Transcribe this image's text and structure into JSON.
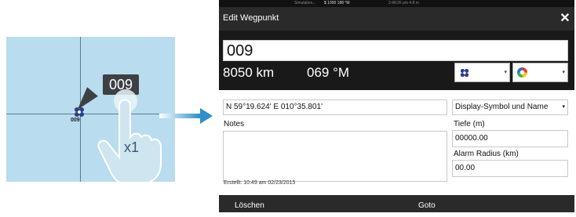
{
  "illustration": {
    "bubble_text": "009",
    "waypoint_label": "009",
    "tap_count": "x1"
  },
  "statusbar": {
    "left": "Simulation...",
    "mid": "$ 1000  188 °M",
    "time": "2:48:26 pm  4.8 m"
  },
  "dialog": {
    "title": "Edit Wegpunkt",
    "name_value": "009",
    "distance": "8050 km",
    "bearing": "069 °M",
    "coordinates": "N 59°19.624'  E 010°35.801'",
    "notes_label": "Notes",
    "notes_value": "",
    "display_option": "Display-Symbol und Name",
    "depth_label": "Tiefe (m)",
    "depth_value": "00000.00",
    "alarm_label": "Alarm Radius (km)",
    "alarm_value": "00.00",
    "created": "Erstellt: 10:49 am  02/23/2015",
    "delete_label": "Löschen",
    "goto_label": "Goto",
    "close_glyph": "✕"
  },
  "colors": {
    "chart_water": "#b9dcee",
    "titlebar": "#2a2a2a",
    "header": "#191919",
    "arrow": "#2f8fc6"
  },
  "icons": [
    "waypoint-icon",
    "hand-pointer-icon",
    "arrow-right-icon",
    "close-icon",
    "symbol-icon",
    "color-wheel-icon",
    "dropdown-arrow-icon"
  ]
}
